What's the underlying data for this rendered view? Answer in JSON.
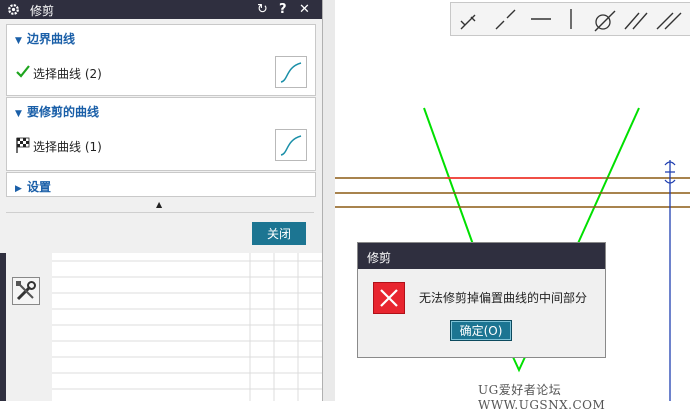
{
  "dialog": {
    "title": "修剪",
    "sections": {
      "boundary": {
        "heading": "边界曲线",
        "row_label": "选择曲线 (2)"
      },
      "trim_curve": {
        "heading": "要修剪的曲线",
        "row_label": "选择曲线 (1)"
      },
      "settings": {
        "heading": "设置"
      }
    },
    "close_label": "关闭"
  },
  "error_dialog": {
    "title": "修剪",
    "message": "无法修剪掉偏置曲线的中间部分",
    "ok_label": "确定(O)"
  },
  "watermark": "UG爱好者论坛 WWW.UGSNX.COM",
  "colors": {
    "title_bar": "#2f2f3f",
    "accent": "#1c7592",
    "heading": "#1a5fa8",
    "green_line": "#00e000",
    "brown_line": "#8b5a14",
    "red_line": "#ff3030",
    "error_red": "#e8252f"
  },
  "icons": {
    "dialog": "gear-icon",
    "reset": "reset-icon",
    "help": "help-icon",
    "close": "close-icon",
    "selected": "check-icon",
    "pending": "checkered-flag-icon",
    "curve": "curve-icon",
    "error": "error-x-icon"
  }
}
